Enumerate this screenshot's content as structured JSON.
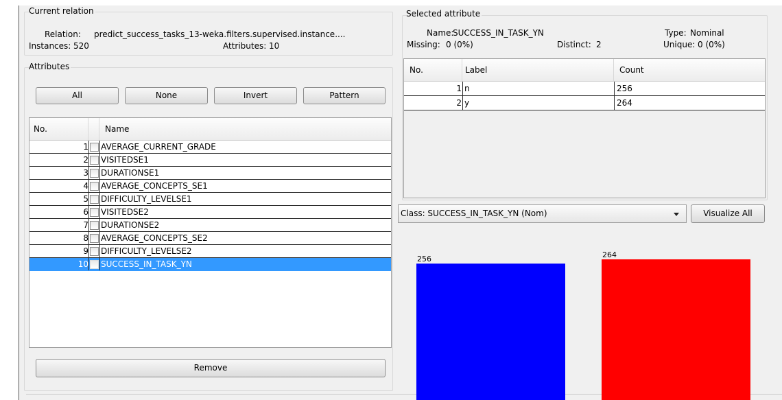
{
  "current_relation": {
    "title": "Current relation",
    "relation_label": "Relation:",
    "relation_value": "predict_success_tasks_13-weka.filters.supervised.instance....",
    "instances_label": "Instances:",
    "instances_value": "520",
    "attributes_label": "Attributes:",
    "attributes_value": "10"
  },
  "attributes": {
    "title": "Attributes",
    "buttons": {
      "all": "All",
      "none": "None",
      "invert": "Invert",
      "pattern": "Pattern"
    },
    "columns": {
      "no": "No.",
      "name": "Name"
    },
    "rows": [
      {
        "no": "1",
        "name": "AVERAGE_CURRENT_GRADE"
      },
      {
        "no": "2",
        "name": "VISITEDSE1"
      },
      {
        "no": "3",
        "name": "DURATIONSE1"
      },
      {
        "no": "4",
        "name": "AVERAGE_CONCEPTS_SE1"
      },
      {
        "no": "5",
        "name": "DIFFICULTY_LEVELSE1"
      },
      {
        "no": "6",
        "name": "VISITEDSE2"
      },
      {
        "no": "7",
        "name": "DURATIONSE2"
      },
      {
        "no": "8",
        "name": "AVERAGE_CONCEPTS_SE2"
      },
      {
        "no": "9",
        "name": "DIFFICULTY_LEVELSE2"
      },
      {
        "no": "10",
        "name": "SUCCESS_IN_TASK_YN"
      }
    ],
    "selected_index": 9,
    "remove_label": "Remove"
  },
  "selected_attribute": {
    "title": "Selected attribute",
    "name_label": "Name:",
    "name_value": "SUCCESS_IN_TASK_YN",
    "type_label": "Type:",
    "type_value": "Nominal",
    "missing_label": "Missing:",
    "missing_value": "0 (0%)",
    "distinct_label": "Distinct:",
    "distinct_value": "2",
    "unique_label": "Unique:",
    "unique_value": "0 (0%)",
    "columns": {
      "no": "No.",
      "label": "Label",
      "count": "Count"
    },
    "rows": [
      {
        "no": "1",
        "label": "n",
        "count": "256"
      },
      {
        "no": "2",
        "label": "y",
        "count": "264"
      }
    ]
  },
  "class_selector": {
    "value": "Class: SUCCESS_IN_TASK_YN (Nom)",
    "visualize_all_label": "Visualize All"
  },
  "chart_data": {
    "type": "bar",
    "categories": [
      "n",
      "y"
    ],
    "values": [
      256,
      264
    ],
    "data_labels": [
      "256",
      "264"
    ],
    "colors": [
      "#0000ff",
      "#ff0000"
    ]
  }
}
